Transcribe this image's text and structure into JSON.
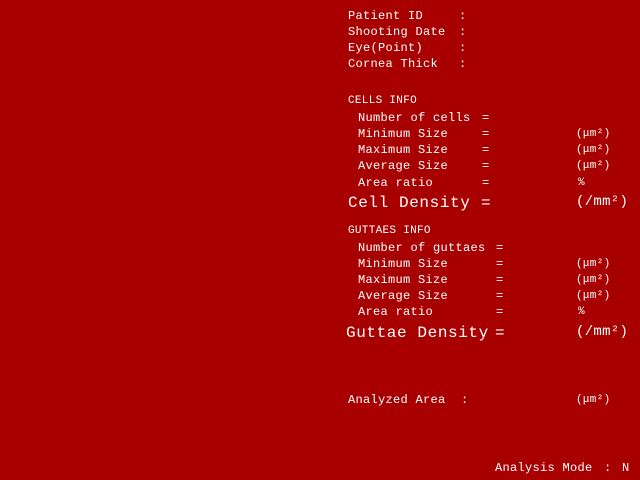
{
  "patient": {
    "id_label": "Patient ID",
    "date_label": "Shooting Date",
    "eye_label": "Eye(Point)",
    "cornea_label": "Cornea Thick",
    "sep": ":"
  },
  "cells": {
    "header": "CELLS INFO",
    "number_label": "Number of cells",
    "min_label": "Minimum Size",
    "max_label": "Maximum Size",
    "avg_label": "Average Size",
    "ratio_label": "Area ratio",
    "eq": "=",
    "unit_um2": "(μm²)",
    "unit_pct": "%",
    "density_label": "Cell Density",
    "density_unit": "(/mm²)"
  },
  "guttae": {
    "header": "GUTTAES INFO",
    "number_label": "Number of guttaes",
    "min_label": "Minimum Size",
    "max_label": "Maximum Size",
    "avg_label": "Average Size",
    "ratio_label": "Area ratio",
    "eq": "=",
    "unit_um2": "(μm²)",
    "unit_pct": "%",
    "density_label": "Guttae Density",
    "density_unit": "(/mm²)"
  },
  "analyzed": {
    "label": "Analyzed Area",
    "sep": ":",
    "unit": "(μm²)"
  },
  "footer": {
    "mode_label": "Analysis Mode",
    "sep": ":",
    "mode_value": "N"
  }
}
